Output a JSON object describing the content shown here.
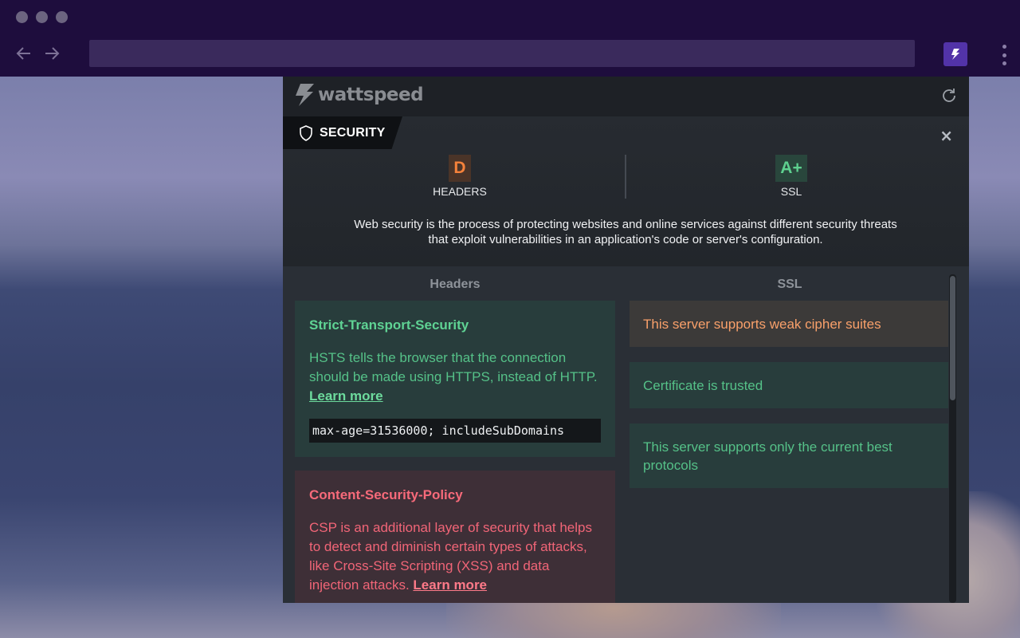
{
  "browser": {
    "back_icon": "arrow-left-icon",
    "forward_icon": "arrow-right-icon",
    "address_value": "",
    "extension_icon": "lightning-bolt-icon",
    "menu_icon": "vertical-dots-icon"
  },
  "panel": {
    "logo_text": "wattspeed",
    "refresh_icon": "refresh-icon",
    "tab_label": "SECURITY",
    "close_label": "×",
    "grades": [
      {
        "letter": "D",
        "label": "HEADERS"
      },
      {
        "letter": "A+",
        "label": "SSL"
      }
    ],
    "description_line1": "Web security is the process of protecting websites and online services against different security threats",
    "description_line2": "that exploit vulnerabilities in an application's code or server's configuration.",
    "headers_title": "Headers",
    "ssl_title": "SSL",
    "headers": [
      {
        "title": "Strict-Transport-Security",
        "body": "HSTS tells the browser that the connection should be made using HTTPS, instead of HTTP.",
        "link": "Learn more",
        "value": "max-age=31536000; includeSubDomains"
      },
      {
        "title": "Content-Security-Policy",
        "body": "CSP is an additional layer of security that helps to detect and diminish certain types of attacks, like Cross-Site Scripting (XSS) and data injection attacks.",
        "link": "Learn more"
      }
    ],
    "ssl": [
      {
        "text": "This server supports weak cipher suites",
        "status": "warning"
      },
      {
        "text": "Certificate is trusted",
        "status": "good"
      },
      {
        "text": "This server supports only the current best protocols",
        "status": "good"
      }
    ]
  },
  "colors": {
    "accent_purple": "#5233a8",
    "good_green": "#5fd394",
    "bad_red": "#f76a7a",
    "warn_orange": "#f9a06a"
  }
}
